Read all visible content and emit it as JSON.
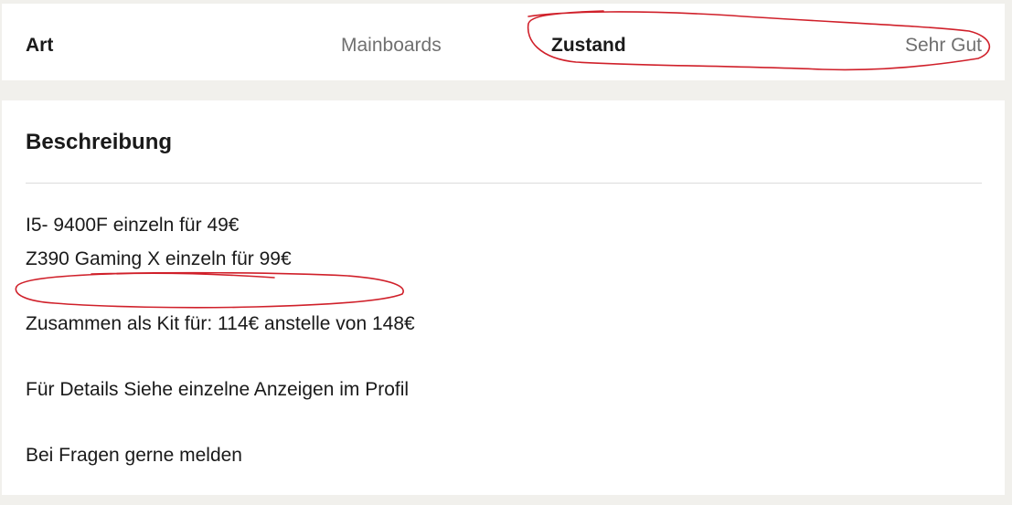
{
  "attributes": [
    {
      "key": "Art",
      "value": "Mainboards"
    },
    {
      "key": "Zustand",
      "value": "Sehr Gut"
    }
  ],
  "description": {
    "title": "Beschreibung",
    "lines": [
      "I5- 9400F einzeln für 49€",
      "Z390 Gaming X einzeln für 99€",
      "Zusammen als Kit für: 114€ anstelle von 148€",
      "Für Details Siehe einzelne Anzeigen im Profil",
      "Bei Fragen gerne melden"
    ]
  },
  "colors": {
    "background": "#f1f0ec",
    "card": "#ffffff",
    "text": "#1a1a1a",
    "muted_text": "#707070",
    "annotation": "#d0202a"
  }
}
